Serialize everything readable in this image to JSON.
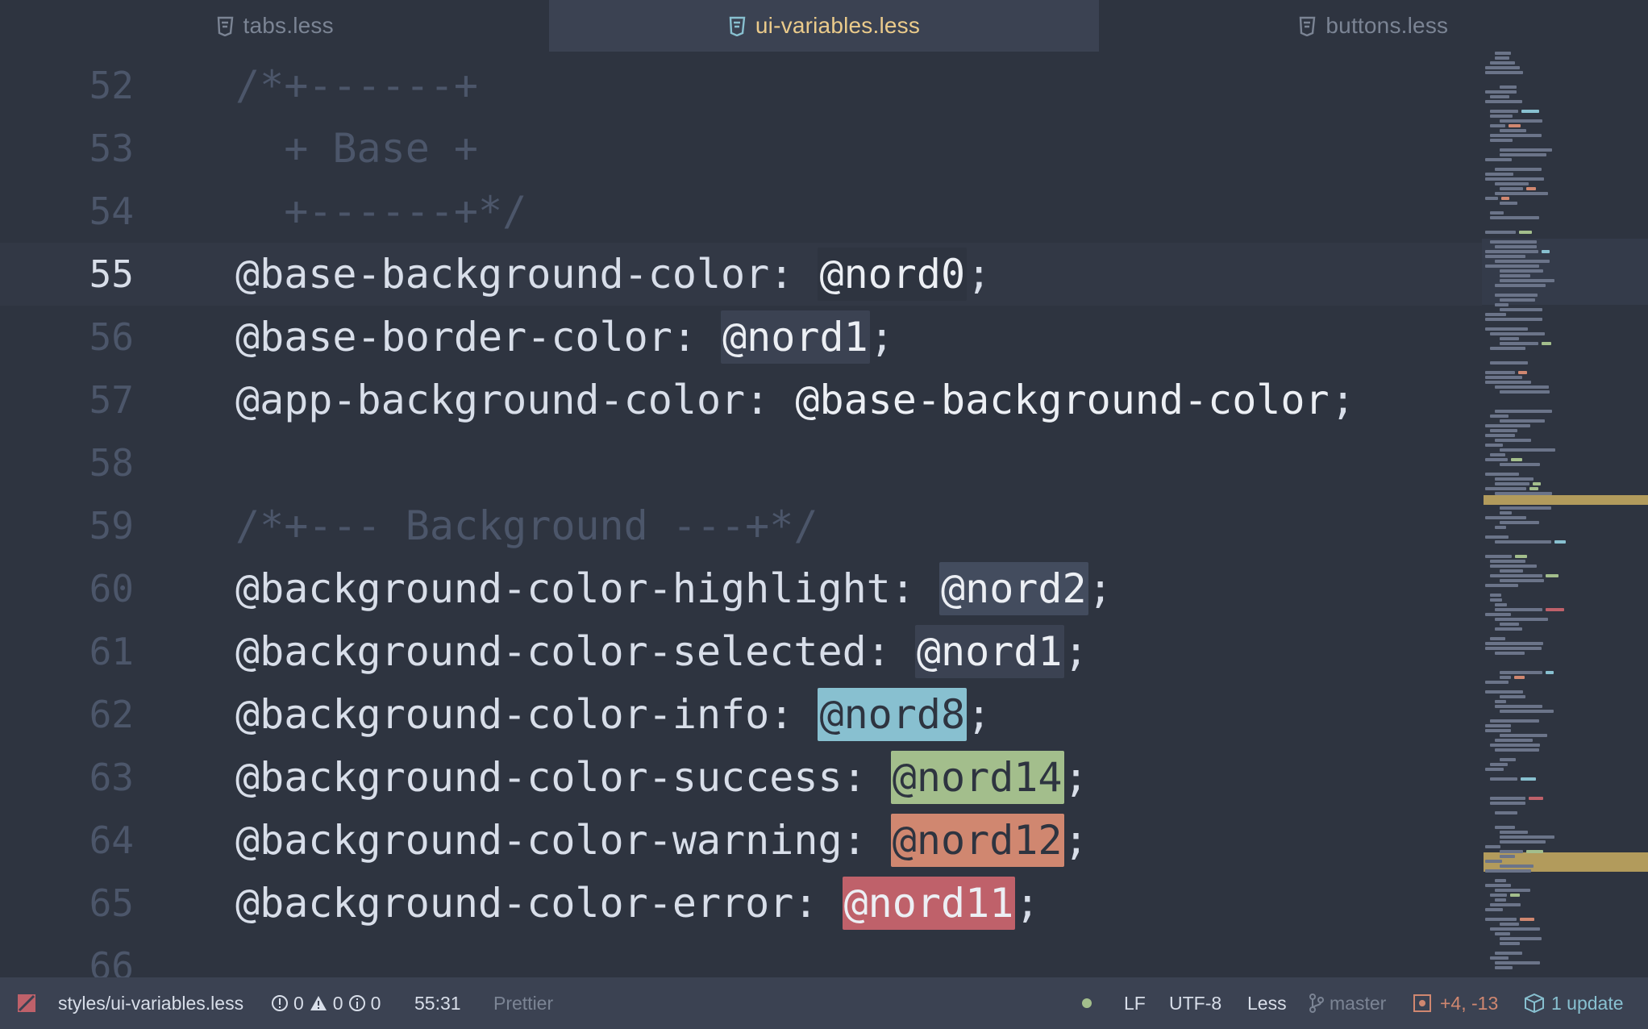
{
  "tabs": [
    {
      "label": "tabs.less",
      "active": false
    },
    {
      "label": "ui-variables.less",
      "active": true
    },
    {
      "label": "buttons.less",
      "active": false
    }
  ],
  "editor": {
    "current_line": 55,
    "lines": [
      {
        "num": "52",
        "text": "/*+------+"
      },
      {
        "num": "53",
        "text": "  + Base +"
      },
      {
        "num": "54",
        "text": "  +------+*/"
      },
      {
        "num": "55",
        "prop": "@base-background-color: ",
        "token": "@nord0",
        "end": ";"
      },
      {
        "num": "56",
        "prop": "@base-border-color: ",
        "token": "@nord1",
        "end": ";"
      },
      {
        "num": "57",
        "prop": "@app-background-color: ",
        "token": "@base-background-color",
        "end": ";"
      },
      {
        "num": "58",
        "text": ""
      },
      {
        "num": "59",
        "text": "/*+--- Background ---+*/"
      },
      {
        "num": "60",
        "prop": "@background-color-highlight: ",
        "token": "@nord2",
        "end": ";"
      },
      {
        "num": "61",
        "prop": "@background-color-selected: ",
        "token": "@nord1",
        "end": ";"
      },
      {
        "num": "62",
        "prop": "@background-color-info: ",
        "token": "@nord8",
        "end": ";"
      },
      {
        "num": "63",
        "prop": "@background-color-success: ",
        "token": "@nord14",
        "end": ";"
      },
      {
        "num": "64",
        "prop": "@background-color-warning: ",
        "token": "@nord12",
        "end": ";"
      },
      {
        "num": "65",
        "prop": "@background-color-error: ",
        "token": "@nord11",
        "end": ";"
      },
      {
        "num": "66",
        "text": ""
      }
    ]
  },
  "statusbar": {
    "file_path": "styles/ui-variables.less",
    "errors": "0",
    "warnings": "0",
    "infos": "0",
    "cursor": "55:31",
    "formatter": "Prettier",
    "line_ending": "LF",
    "encoding": "UTF-8",
    "grammar": "Less",
    "branch": "master",
    "diff": "+4, -13",
    "updates": "1 update"
  },
  "colors": {
    "background": "#2e3440",
    "tab_active_text": "#ebcb8b",
    "nord8": "#88c0d0",
    "nord11": "#bf616a",
    "nord12": "#d08770",
    "nord14": "#a3be8c",
    "git_diff": "#d08770",
    "update_accent": "#88c0d0",
    "status_dot": "#a3be8c"
  }
}
